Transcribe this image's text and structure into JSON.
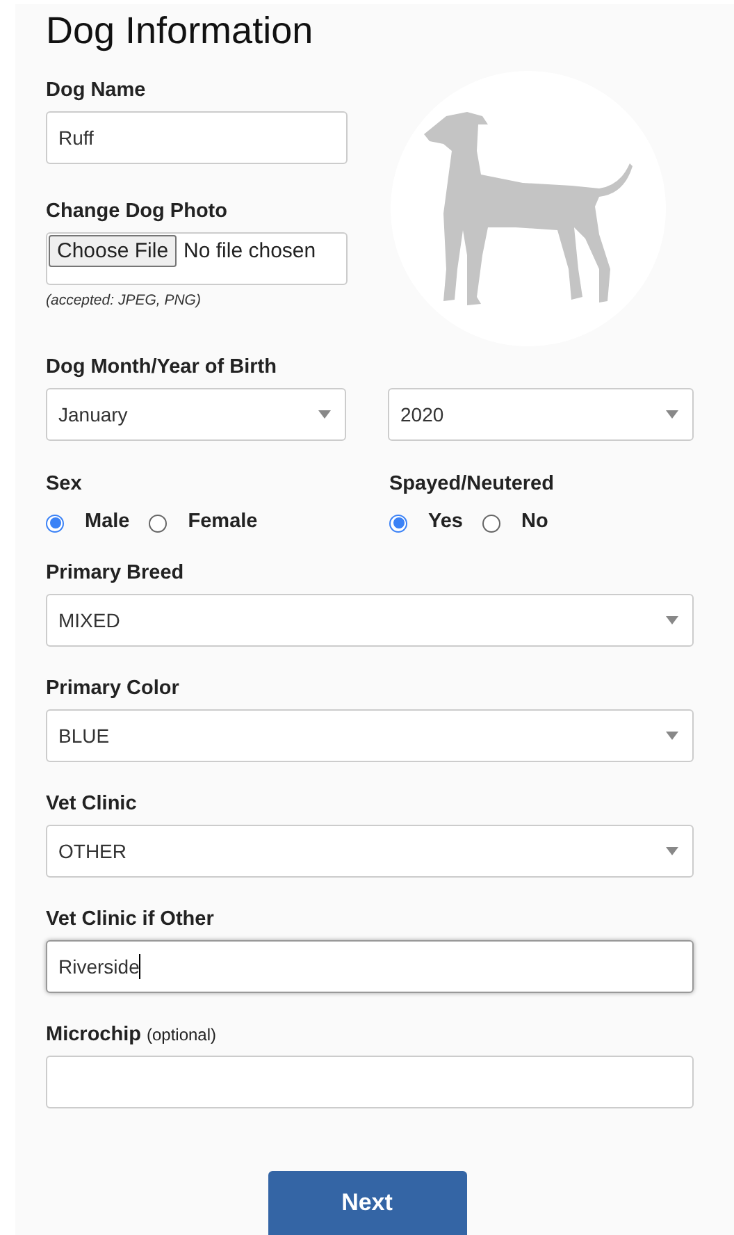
{
  "title": "Dog Information",
  "dog_name": {
    "label": "Dog Name",
    "value": "Ruff"
  },
  "photo": {
    "label": "Change Dog Photo",
    "button": "Choose File",
    "status": "No file chosen",
    "hint": "(accepted: JPEG, PNG)"
  },
  "birth": {
    "label": "Dog Month/Year of Birth",
    "month": "January",
    "year": "2020"
  },
  "radio_groups": [
    {
      "label": "Sex",
      "options": [
        {
          "label": "Male",
          "selected": true
        },
        {
          "label": "Female",
          "selected": false
        }
      ]
    },
    {
      "label": "Spayed/Neutered",
      "options": [
        {
          "label": "Yes",
          "selected": true
        },
        {
          "label": "No",
          "selected": false
        }
      ]
    }
  ],
  "fields": [
    {
      "kind": "select",
      "label": "Primary Breed",
      "value": "MIXED"
    },
    {
      "kind": "select",
      "label": "Primary Color",
      "value": "BLUE"
    },
    {
      "kind": "select",
      "label": "Vet Clinic",
      "value": "OTHER"
    },
    {
      "kind": "text",
      "label": "Vet Clinic if Other",
      "value": "Riverside",
      "focused": true
    },
    {
      "kind": "text",
      "label": "Microchip",
      "note": "(optional)",
      "focused": false
    }
  ],
  "next_button": "Next"
}
